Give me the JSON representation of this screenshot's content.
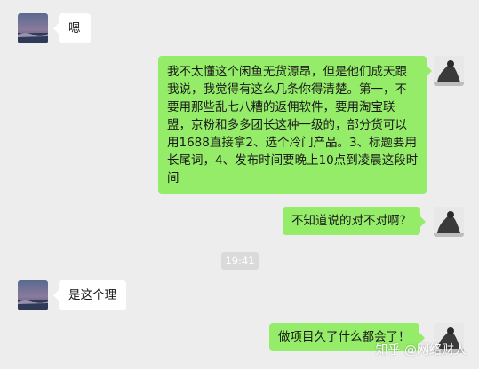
{
  "colors": {
    "background": "#ededed",
    "outgoing_bubble": "#95ec69",
    "incoming_bubble": "#ffffff",
    "timestamp_bg": "#dadada"
  },
  "messages": [
    {
      "direction": "incoming",
      "text": "嗯"
    },
    {
      "direction": "outgoing",
      "text": "我不太懂这个闲鱼无货源昂，但是他们成天跟我说，我觉得有这么几条你得清楚。第一，不要用那些乱七八糟的返佣软件，要用淘宝联盟，京粉和多多团长这种一级的，部分货可以用1688直接拿2、选个冷门产品。3、标题要用长尾词，4、发布时间要晚上10点到凌晨这段时间"
    },
    {
      "direction": "outgoing",
      "text": "不知道说的对不对啊？"
    },
    {
      "direction": "incoming",
      "text": "是这个理"
    },
    {
      "direction": "outgoing",
      "text": "做项目久了什么都会了！"
    }
  ],
  "timestamp": "19:41",
  "watermark": "知乎 @网络财人"
}
